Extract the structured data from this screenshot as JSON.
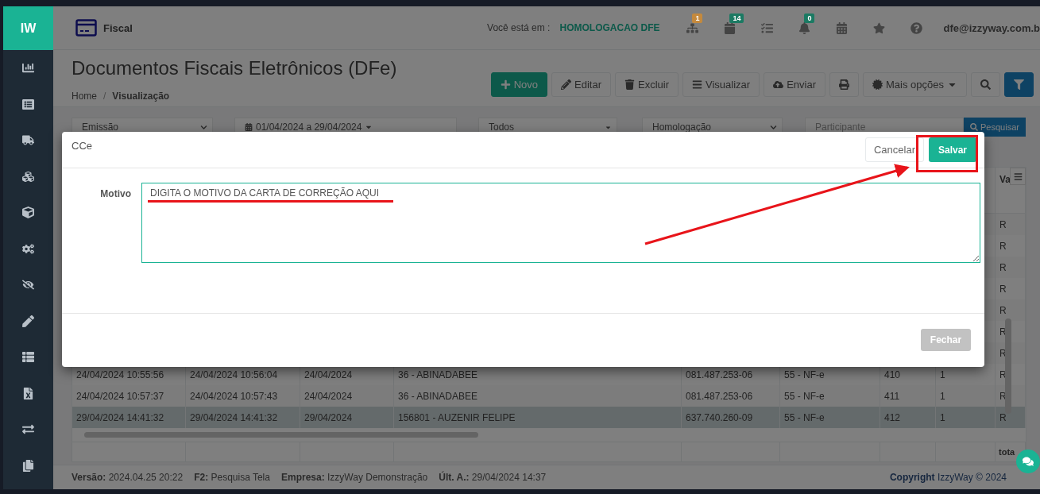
{
  "sidebar": {
    "logo": "IW"
  },
  "header": {
    "module": "Fiscal",
    "location_label": "Você está em :",
    "location": "HOMOLOGACAO DFE",
    "icons": [
      {
        "kind": "sitemap",
        "badge": "1",
        "color": "#c4893d"
      },
      {
        "kind": "grid",
        "badge": "14",
        "color": "#1b7a63"
      },
      {
        "kind": "tasks"
      },
      {
        "kind": "bell",
        "badge": "0",
        "color": "#1b7a63"
      },
      {
        "kind": "calendar"
      },
      {
        "kind": "star"
      },
      {
        "kind": "help"
      }
    ],
    "user": "dfe@izzyway.com.b"
  },
  "page": {
    "title": "Documentos Fiscais Eletrônicos (DFe)",
    "breadcrumb": [
      {
        "label": "Home",
        "selected": false
      },
      {
        "label": "Visualização",
        "selected": true
      }
    ],
    "breadcrumb_separator": "/"
  },
  "toolbar": [
    {
      "kind": "new",
      "label": "Novo"
    },
    {
      "kind": "edit",
      "label": "Editar"
    },
    {
      "kind": "delete",
      "label": "Excluir"
    },
    {
      "kind": "view",
      "label": "Visualizar"
    },
    {
      "kind": "send",
      "label": "Enviar"
    },
    {
      "kind": "print"
    },
    {
      "kind": "more",
      "label": "Mais opções"
    },
    {
      "kind": "search"
    },
    {
      "kind": "filter"
    }
  ],
  "filters": {
    "date_type": "Emissão",
    "date_range": "01/04/2024 a 29/04/2024",
    "status": "Todos",
    "environment": "Homologação",
    "participant": {
      "placeholder": "Participante"
    },
    "search_button": "Pesquisar"
  },
  "table": {
    "header": {
      "column_9": "Va"
    },
    "rows": [
      {
        "selected": false,
        "column_9": "R"
      },
      {
        "selected": false,
        "column_9": "R"
      },
      {
        "selected": false,
        "column_9": "R"
      },
      {
        "selected": false,
        "column_9": "R"
      },
      {
        "selected": false,
        "column_9": "R"
      },
      {
        "selected": false,
        "column_9": "R"
      },
      {
        "selected": false,
        "column_9": "R"
      },
      {
        "selected": false,
        "column_1": "24/04/2024 10:55:56",
        "column_2": "24/04/2024 10:56:04",
        "column_3": "24/04/2024",
        "column_4": "36 - ABINADABEE",
        "column_5": "081.487.253-06",
        "column_6": "55 - NF-e",
        "column_7": "410",
        "column_8": "1",
        "column_9": "R"
      },
      {
        "selected": false,
        "column_1": "24/04/2024 10:57:37",
        "column_2": "24/04/2024 10:57:43",
        "column_3": "24/04/2024",
        "column_4": "36 - ABINADABEE",
        "column_5": "081.487.253-06",
        "column_6": "55 - NF-e",
        "column_7": "411",
        "column_8": "1",
        "column_9": "R"
      },
      {
        "selected": true,
        "column_1": "29/04/2024 14:41:32",
        "column_2": "29/04/2024 14:41:32",
        "column_3": "29/04/2024",
        "column_4": "156801 - AUZENIR FELIPE",
        "column_5": "637.740.260-09",
        "column_6": "55 - NF-e",
        "column_7": "412",
        "column_8": "1",
        "column_9": "R"
      }
    ],
    "totals": {
      "column_9": "tota"
    }
  },
  "footer": {
    "items": [
      "**Versão:** 2024.04.25 20:22",
      "**F2:** Pesquisa Tela",
      "**Empresa:** IzzyWay Demonstração",
      "**Últ. A.:** 29/04/2024 14:37"
    ],
    "copyright": "**Copyright** IzzyWay © 2024"
  },
  "modal": {
    "title": "CCe",
    "cancel": "Cancelar",
    "save": "Salvar",
    "field_label": "Motivo",
    "field_value": "DIGITA O MOTIVO DA CARTA DE CORREÇÃO AQUI",
    "close": {
      "label": "Fechar",
      "disabled": true
    }
  }
}
